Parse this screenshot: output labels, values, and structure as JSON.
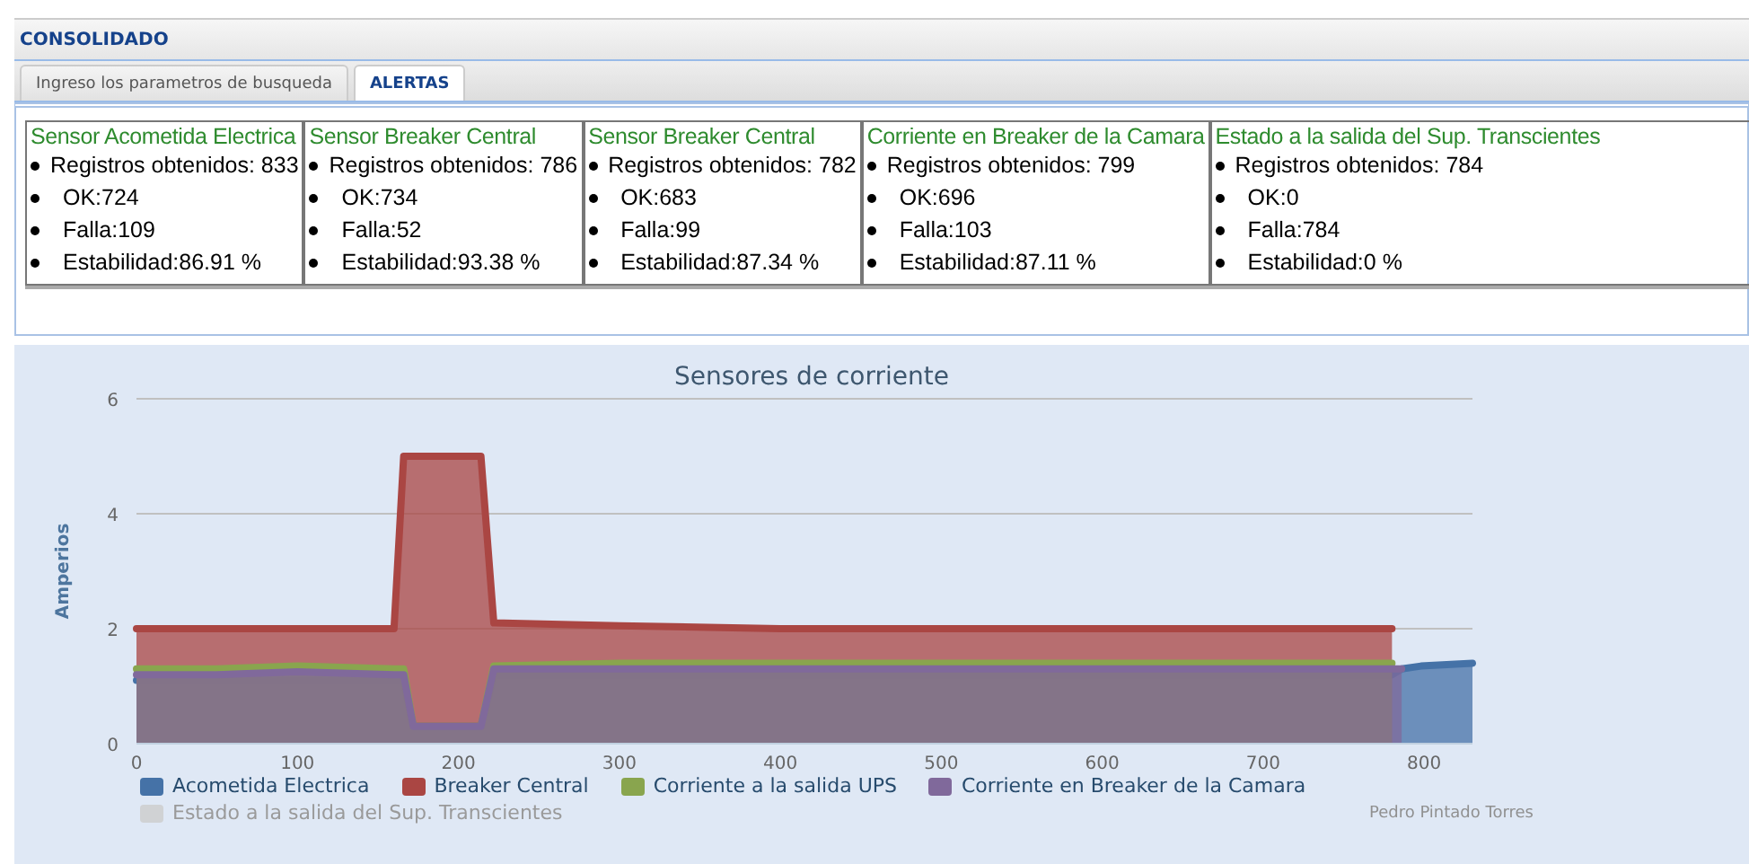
{
  "header": {
    "title": "CONSOLIDADO"
  },
  "tabs": [
    {
      "label": "Ingreso los parametros de busqueda",
      "selected": false
    },
    {
      "label": "ALERTAS",
      "selected": true
    }
  ],
  "cards": [
    {
      "title": "Sensor Acometida Electrica",
      "items": [
        "Registros obtenidos: 833",
        "OK:724",
        "Falla:109",
        "Estabilidad:86.91 %"
      ]
    },
    {
      "title": "Sensor Breaker Central",
      "items": [
        "Registros obtenidos: 786",
        "OK:734",
        "Falla:52",
        "Estabilidad:93.38 %"
      ]
    },
    {
      "title": "Sensor Breaker Central",
      "items": [
        "Registros obtenidos: 782",
        "OK:683",
        "Falla:99",
        "Estabilidad:87.34 %"
      ]
    },
    {
      "title": "Corriente en Breaker de la Camara",
      "items": [
        "Registros obtenidos: 799",
        "OK:696",
        "Falla:103",
        "Estabilidad:87.11 %"
      ]
    },
    {
      "title": "Estado a la salida del Sup. Transcientes",
      "items": [
        "Registros obtenidos: 784",
        "OK:0",
        "Falla:784",
        "Estabilidad:0 %"
      ]
    }
  ],
  "chart": {
    "chart_data": {
      "type": "area",
      "title": "Sensores de corriente",
      "ylabel": "Amperios",
      "x": [
        0,
        50,
        100,
        160,
        166,
        172,
        214,
        222,
        300,
        400,
        500,
        600,
        700,
        780,
        786,
        798,
        830
      ],
      "series": [
        {
          "name": "Acometida Electrica",
          "color": "#4572a7",
          "values": [
            1.1,
            1.1,
            1.1,
            1.1,
            1.1,
            0.3,
            0.3,
            1.2,
            1.2,
            1.2,
            1.2,
            1.2,
            1.2,
            1.2,
            1.3,
            1.35,
            1.4
          ]
        },
        {
          "name": "Breaker Central",
          "color": "#aa4643",
          "values": [
            2,
            2,
            2,
            2,
            5,
            5,
            5,
            2.1,
            2.05,
            2,
            2,
            2,
            2,
            2,
            null,
            null,
            null
          ]
        },
        {
          "name": "Corriente a la salida UPS",
          "color": "#89a54e",
          "values": [
            1.3,
            1.3,
            1.35,
            1.3,
            1.3,
            0.3,
            0.3,
            1.35,
            1.4,
            1.4,
            1.4,
            1.4,
            1.4,
            1.4,
            null,
            null,
            null
          ]
        },
        {
          "name": "Corriente en Breaker de la Camara",
          "color": "#80699b",
          "values": [
            1.2,
            1.2,
            1.25,
            1.2,
            1.2,
            0.3,
            0.3,
            1.3,
            1.3,
            1.3,
            1.3,
            1.3,
            1.3,
            1.3,
            1.3,
            null,
            null
          ]
        },
        {
          "name": "Estado a la salida del Sup. Transcientes",
          "color": "#cccccc",
          "values": [
            null,
            null,
            null,
            null,
            null,
            null,
            null,
            null,
            null,
            null,
            null,
            null,
            null,
            null,
            null,
            null,
            null
          ]
        }
      ],
      "xlim": [
        0,
        830
      ],
      "ylim": [
        0,
        6
      ],
      "xticks": [
        0,
        100,
        200,
        300,
        400,
        500,
        600,
        700,
        800
      ],
      "yticks": [
        0,
        2,
        4,
        6
      ]
    },
    "legend": [
      {
        "hidden": false
      },
      {
        "hidden": false
      },
      {
        "hidden": false
      },
      {
        "hidden": false
      },
      {
        "hidden": true
      }
    ],
    "credit": "Pedro Pintado Torres"
  }
}
